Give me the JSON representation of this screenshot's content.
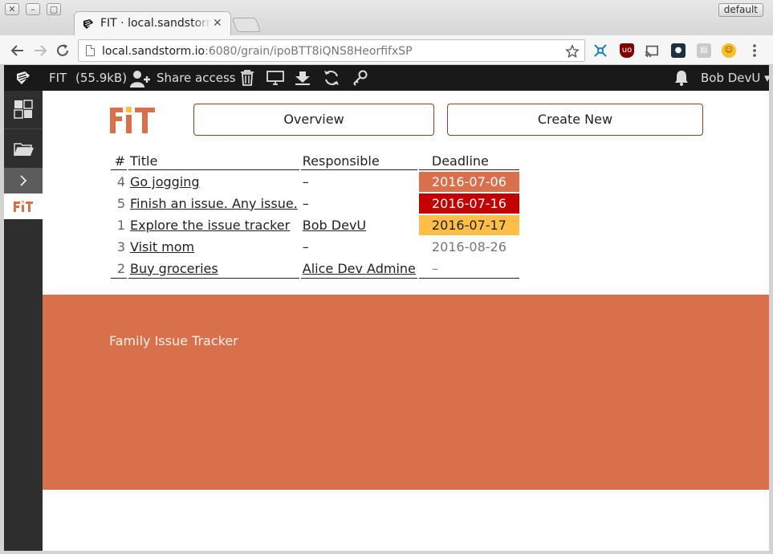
{
  "browser": {
    "window_buttons": [
      "✕",
      "–",
      "▢"
    ],
    "tab_title": "FIT · local.sandstorm",
    "tab_close": "✕",
    "profile": "default",
    "url_host": "local.sandstorm.io",
    "url_rest": ":6080/grain/ipoBTT8iQNS8HeorfifxSP"
  },
  "topbar": {
    "grain_name": "FIT",
    "grain_size": "(55.9kB)",
    "share_label": "Share access",
    "user_label": "Bob DevU ▾"
  },
  "app": {
    "logo_text": "FiT",
    "overview_label": "Overview",
    "create_label": "Create New",
    "footer_text": "Family Issue Tracker"
  },
  "table": {
    "headers": {
      "num": "#",
      "title": "Title",
      "responsible": "Responsible",
      "deadline": "Deadline"
    },
    "rows": [
      {
        "num": "4",
        "title": "Go jogging",
        "responsible": "–",
        "deadline": "2016-07-06",
        "status": "overdue"
      },
      {
        "num": "5",
        "title": "Finish an issue. Any issue.",
        "responsible": "–",
        "deadline": "2016-07-16",
        "status": "urgent"
      },
      {
        "num": "1",
        "title": "Explore the issue tracker",
        "responsible": "Bob DevU",
        "deadline": "2016-07-17",
        "status": "soon"
      },
      {
        "num": "3",
        "title": "Visit mom",
        "responsible": "–",
        "deadline": "2016-08-26",
        "status": "future"
      },
      {
        "num": "2",
        "title": "Buy groceries",
        "responsible": "Alice Dev Admine",
        "deadline": "–",
        "status": "none"
      }
    ]
  },
  "colors": {
    "accent": "#d8704b",
    "overdue": "#d8704b",
    "urgent": "#c30000",
    "soon": "#ffbe48",
    "topbar": "#191919",
    "sidebar": "#2e2e2e"
  },
  "icons": {
    "topbar": [
      "sandstorm-logo-icon",
      "share-person-icon",
      "trash-icon",
      "monitor-icon",
      "download-icon",
      "refresh-icon",
      "key-icon",
      "bell-icon"
    ],
    "sidebar": [
      "grid-icon",
      "folder-icon",
      "chevron-right-icon",
      "fit-app-icon"
    ],
    "toolbar": [
      "back-arrow-icon",
      "forward-arrow-icon",
      "reload-icon",
      "page-icon",
      "star-icon",
      "menu-dots-icon"
    ]
  }
}
